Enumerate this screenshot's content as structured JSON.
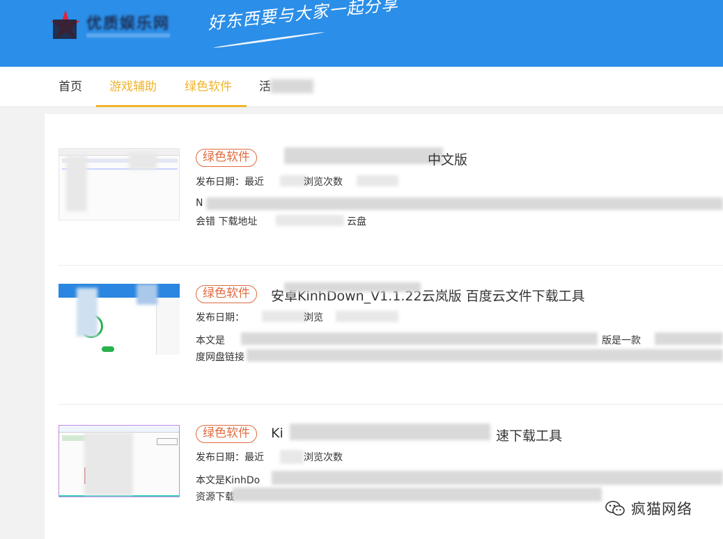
{
  "header": {
    "site_name": "优质娱乐网",
    "slogan": "好东西要与大家一起分享",
    "bg_color": "#2b8ee8"
  },
  "nav": {
    "items": [
      {
        "label": "首页",
        "active": false
      },
      {
        "label": "游戏辅助",
        "active": true
      },
      {
        "label": "绿色软件",
        "active": true
      },
      {
        "label": "活",
        "active": false
      }
    ],
    "accent_color": "#f0b32a"
  },
  "posts": [
    {
      "tag": "绿色软件",
      "title": "中文版",
      "date_label": "发布日期：最近",
      "views_label": "浏览次数",
      "excerpt_line1": "N",
      "excerpt_line2_a": "会错 下载地址",
      "excerpt_line2_b": "云盘"
    },
    {
      "tag": "绿色软件",
      "title": "安卓KinhDown_V1.1.22云岚版 百度云文件下载工具",
      "date_label": "发布日期：",
      "views_label": "浏览",
      "excerpt_line1_a": "本文是",
      "excerpt_line1_b": "版是一款",
      "excerpt_line2": "度网盘链接"
    },
    {
      "tag": "绿色软件",
      "title_a": "Ki",
      "title_b": "速下载工具",
      "date_label": "发布日期：最近",
      "views_label": "浏览次数",
      "excerpt_line1": "本文是KinhDo",
      "excerpt_line2": "资源下载"
    }
  ],
  "watermark": {
    "text": "疯猫网络",
    "icon": "wechat-icon"
  },
  "colors": {
    "tag_color": "#e06a3f"
  }
}
